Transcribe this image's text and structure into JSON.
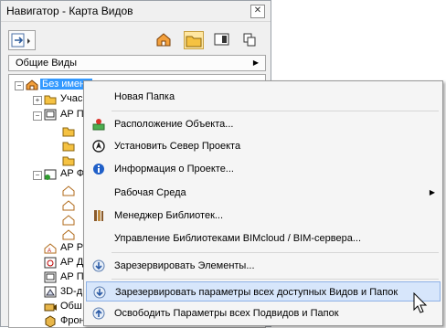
{
  "window": {
    "title": "Навигатор - Карта Видов",
    "close_glyph": "✕"
  },
  "dropdown": {
    "label": "Общие Виды",
    "arrow": "▶"
  },
  "tree": {
    "root_label": "Без имени",
    "items": [
      "Учас",
      "АР П",
      "АР Ф",
      "АР Р",
      "АР Д",
      "АР П",
      "3D-д",
      "Обш",
      "Фрон"
    ]
  },
  "menu": {
    "items": [
      {
        "label": "Новая Папка",
        "icon": "none"
      },
      {
        "label": "Расположение Объекта...",
        "icon": "location-icon"
      },
      {
        "label": "Установить Север Проекта",
        "icon": "north-arrow-icon"
      },
      {
        "label": "Информация о Проекте...",
        "icon": "info-icon"
      },
      {
        "label": "Рабочая Среда",
        "icon": "none",
        "submenu": true
      },
      {
        "label": "Менеджер Библиотек...",
        "icon": "library-icon"
      },
      {
        "label": "Управление Библиотеками BIMcloud / BIM-сервера...",
        "icon": "none"
      },
      {
        "label": "Зарезервировать Элементы...",
        "icon": "reserve-icon"
      },
      {
        "label": "Зарезервировать параметры всех доступных Видов и Папок",
        "icon": "reserve-icon",
        "highlighted": true
      },
      {
        "label": "Освободить Параметры всех Подвидов и Папок",
        "icon": "release-icon"
      }
    ],
    "submenu_arrow": "▶"
  },
  "colors": {
    "selection": "#3399ff",
    "menu_highlight": "#d7e6fb",
    "folder": "#f5c242"
  }
}
